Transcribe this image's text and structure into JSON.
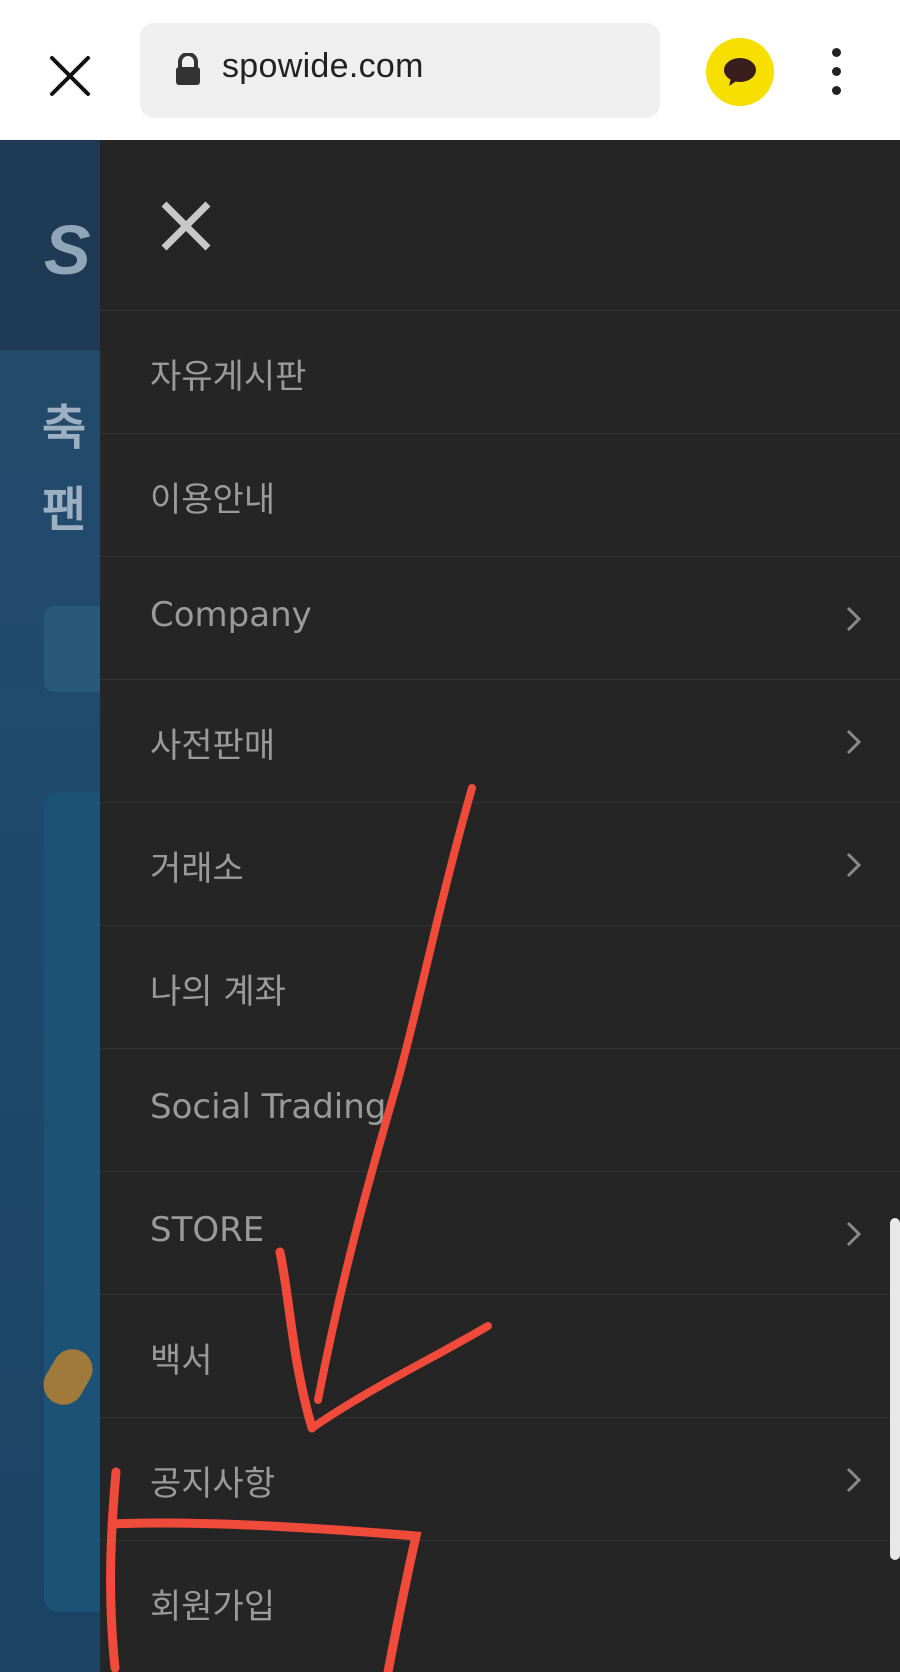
{
  "browser": {
    "url": "spowide.com",
    "close_icon": "close-icon",
    "lock_icon": "lock-icon",
    "kakao_icon": "chat-bubble-icon",
    "menu_icon": "more-vert-icon"
  },
  "drawer": {
    "close_icon": "close-icon",
    "items": [
      {
        "label": "자유게시판",
        "has_submenu": false
      },
      {
        "label": "이용안내",
        "has_submenu": false
      },
      {
        "label": "Company",
        "has_submenu": true
      },
      {
        "label": "사전판매",
        "has_submenu": true
      },
      {
        "label": "거래소",
        "has_submenu": true
      },
      {
        "label": "나의 계좌",
        "has_submenu": false
      },
      {
        "label": "Social Trading",
        "has_submenu": false
      },
      {
        "label": "STORE",
        "has_submenu": true
      },
      {
        "label": "백서",
        "has_submenu": false
      },
      {
        "label": "공지사항",
        "has_submenu": true
      },
      {
        "label": "회원가입",
        "has_submenu": false
      }
    ]
  },
  "background": {
    "title_line1": "축",
    "title_line2": "팬"
  },
  "colors": {
    "drawer_bg": "#252525",
    "menu_text": "#9a9a9a",
    "annotation": "#f04a3a",
    "kakao": "#f7df00"
  }
}
